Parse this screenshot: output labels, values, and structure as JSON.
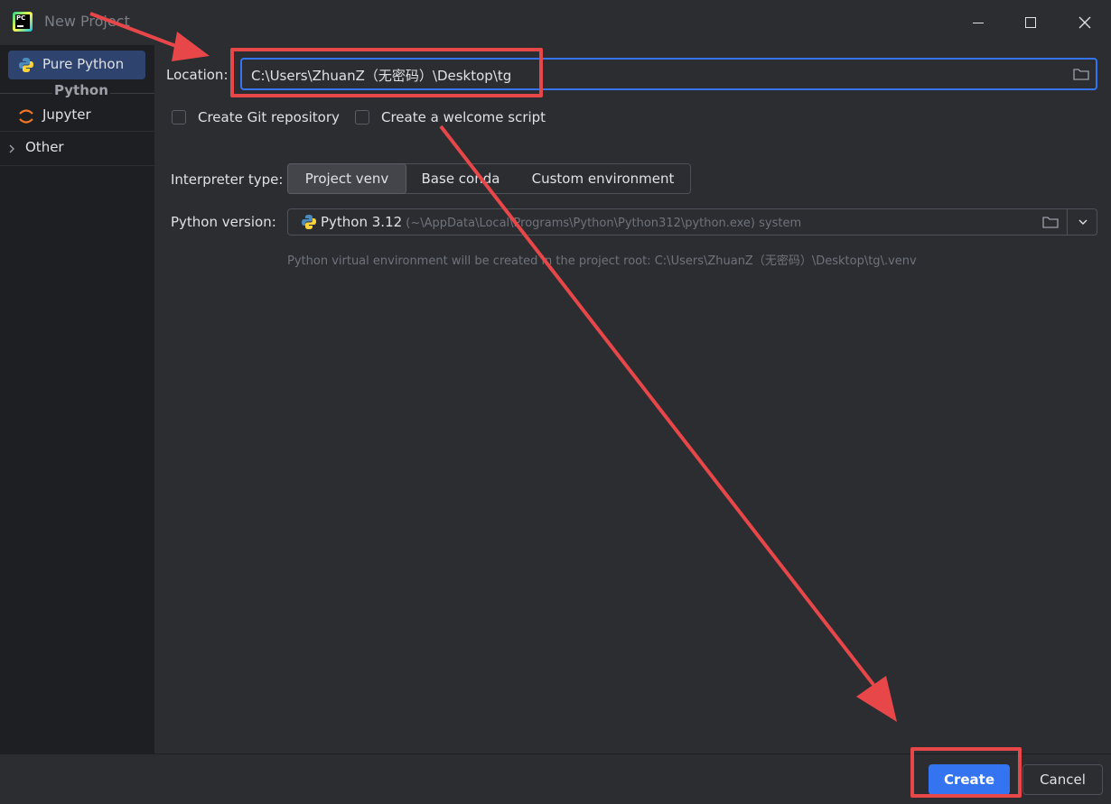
{
  "window": {
    "title": "New Project",
    "app_logo_text": "PC"
  },
  "sidebar": {
    "items": [
      {
        "label": "Pure Python",
        "icon": "python-icon",
        "selected": true
      },
      {
        "label": "Jupyter",
        "icon": "jupyter-icon"
      },
      {
        "label": "Other",
        "icon": "chevron-right-icon"
      }
    ],
    "group_label": "Python"
  },
  "form": {
    "location_label": "Location:",
    "location_value": "C:\\Users\\ZhuanZ（无密码）\\Desktop\\tg",
    "create_git_label": "Create Git repository",
    "welcome_script_label": "Create a welcome script",
    "interpreter_label": "Interpreter type:",
    "interpreter_options": [
      "Project venv",
      "Base conda",
      "Custom environment"
    ],
    "python_version_label": "Python version:",
    "python_version_name": "Python 3.12",
    "python_version_path": " (~\\AppData\\Local\\Programs\\Python\\Python312\\python.exe) system",
    "venv_hint": "Python virtual environment will be created in the project root: C:\\Users\\ZhuanZ（无密码）\\Desktop\\tg\\.venv"
  },
  "footer": {
    "create_label": "Create",
    "cancel_label": "Cancel"
  },
  "colors": {
    "accent": "#3574f0",
    "annotation": "#e8474a",
    "selected_item": "#2e436e"
  }
}
